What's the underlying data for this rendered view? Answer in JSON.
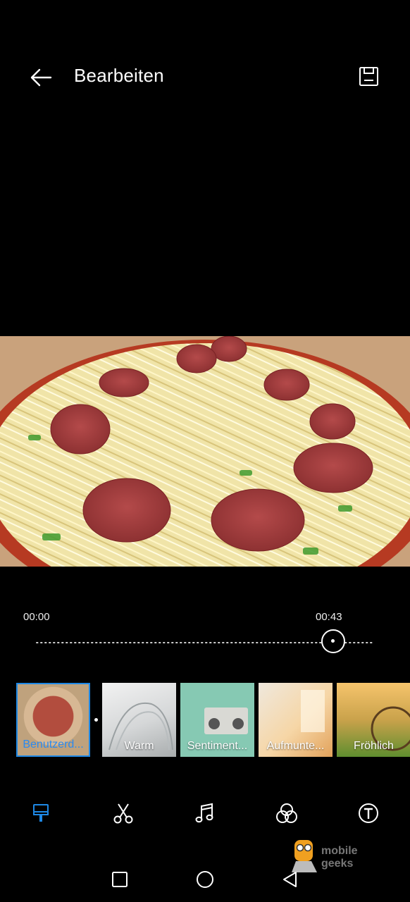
{
  "header": {
    "title": "Bearbeiten",
    "back_icon": "arrow-left-icon",
    "save_icon": "save-icon"
  },
  "timeline": {
    "start_time": "00:00",
    "end_time": "00:43",
    "playhead_fraction": 0.88
  },
  "filters": [
    {
      "label": "Benutzerd...",
      "selected": true
    },
    {
      "label": "Warm",
      "selected": false
    },
    {
      "label": "Sentiment...",
      "selected": false
    },
    {
      "label": "Aufmunte...",
      "selected": false
    },
    {
      "label": "Fröhlich",
      "selected": false
    }
  ],
  "toolbar": {
    "items": [
      "brush-icon",
      "scissors-icon",
      "music-note-icon",
      "filter-circles-icon",
      "text-icon"
    ],
    "active_color": "#1e88e5"
  },
  "navigation_bar": [
    "recents-square-icon",
    "home-circle-icon",
    "back-triangle-icon"
  ],
  "watermark": {
    "line1": "mobile",
    "line2": "geeks"
  }
}
